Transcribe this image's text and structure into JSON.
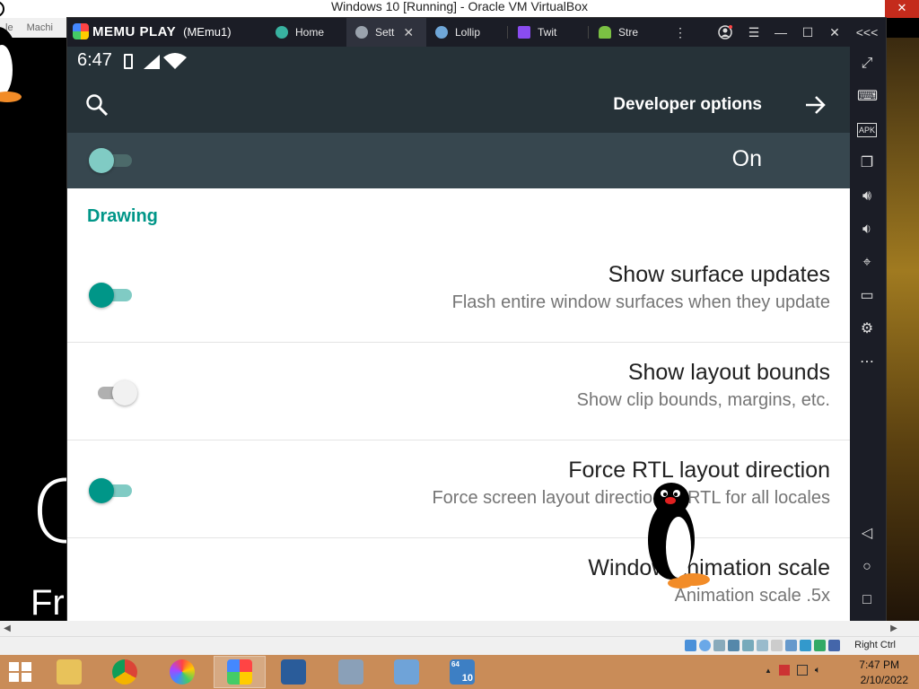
{
  "host": {
    "title": "Windows 10 [Running] - Oracle VM VirtualBox",
    "close_glyph": "✕",
    "menu": [
      "le",
      "Machi"
    ],
    "hostkey": "Right Ctrl",
    "desktop_text_big": "C",
    "desktop_text_small": "Fr"
  },
  "memu": {
    "brand": "MEMU PLAY",
    "instance": "(MEmu1)",
    "tabs": [
      {
        "label": "Home",
        "icon_color": "#38b2a0"
      },
      {
        "label": "Sett",
        "icon_color": "#9aa3ad",
        "active": true,
        "close": "✕"
      },
      {
        "label": "Lollip",
        "icon_color": "#6fa7d8"
      },
      {
        "label": "Twit",
        "icon_color": "#8a4cf0"
      },
      {
        "label": "Stre",
        "icon_color": "#7bc043"
      }
    ],
    "controls": {
      "more": "⋮",
      "menu": "☰",
      "minimize": "—",
      "maximize": "☐",
      "close": "✕",
      "collapse": "<<<"
    },
    "side_icons": [
      "expand-icon",
      "keyboard-icon",
      "apk-icon",
      "multi-window-icon",
      "volume-up-icon",
      "volume-down-icon",
      "location-icon",
      "folder-icon",
      "settings-icon",
      "more-icon",
      "back-icon",
      "home-icon",
      "recents-icon"
    ]
  },
  "android": {
    "time": "6:47",
    "appbar_title": "Developer options",
    "master_switch_label": "On",
    "section": "Drawing",
    "prefs": [
      {
        "title": "Show surface updates",
        "summary": "Flash entire window surfaces when they update",
        "checked": true
      },
      {
        "title": "Show layout bounds",
        "summary": "Show clip bounds, margins, etc.",
        "checked": false
      },
      {
        "title": "Force RTL layout direction",
        "summary": "Force screen layout direction to RTL for all locales",
        "checked": true
      },
      {
        "title": "Window animation scale",
        "summary": "Animation scale .5x"
      }
    ]
  },
  "taskbar": {
    "apps": [
      "file-explorer-icon",
      "chrome-icon",
      "photos-icon",
      "memu-icon",
      "virtualbox-icon",
      "tools-icon",
      "control-panel-icon",
      "win10-vm-icon"
    ],
    "badge_64": "64",
    "badge_10": "10",
    "time": "7:47 PM",
    "date": "2/10/2022",
    "tray_up": "▲"
  }
}
